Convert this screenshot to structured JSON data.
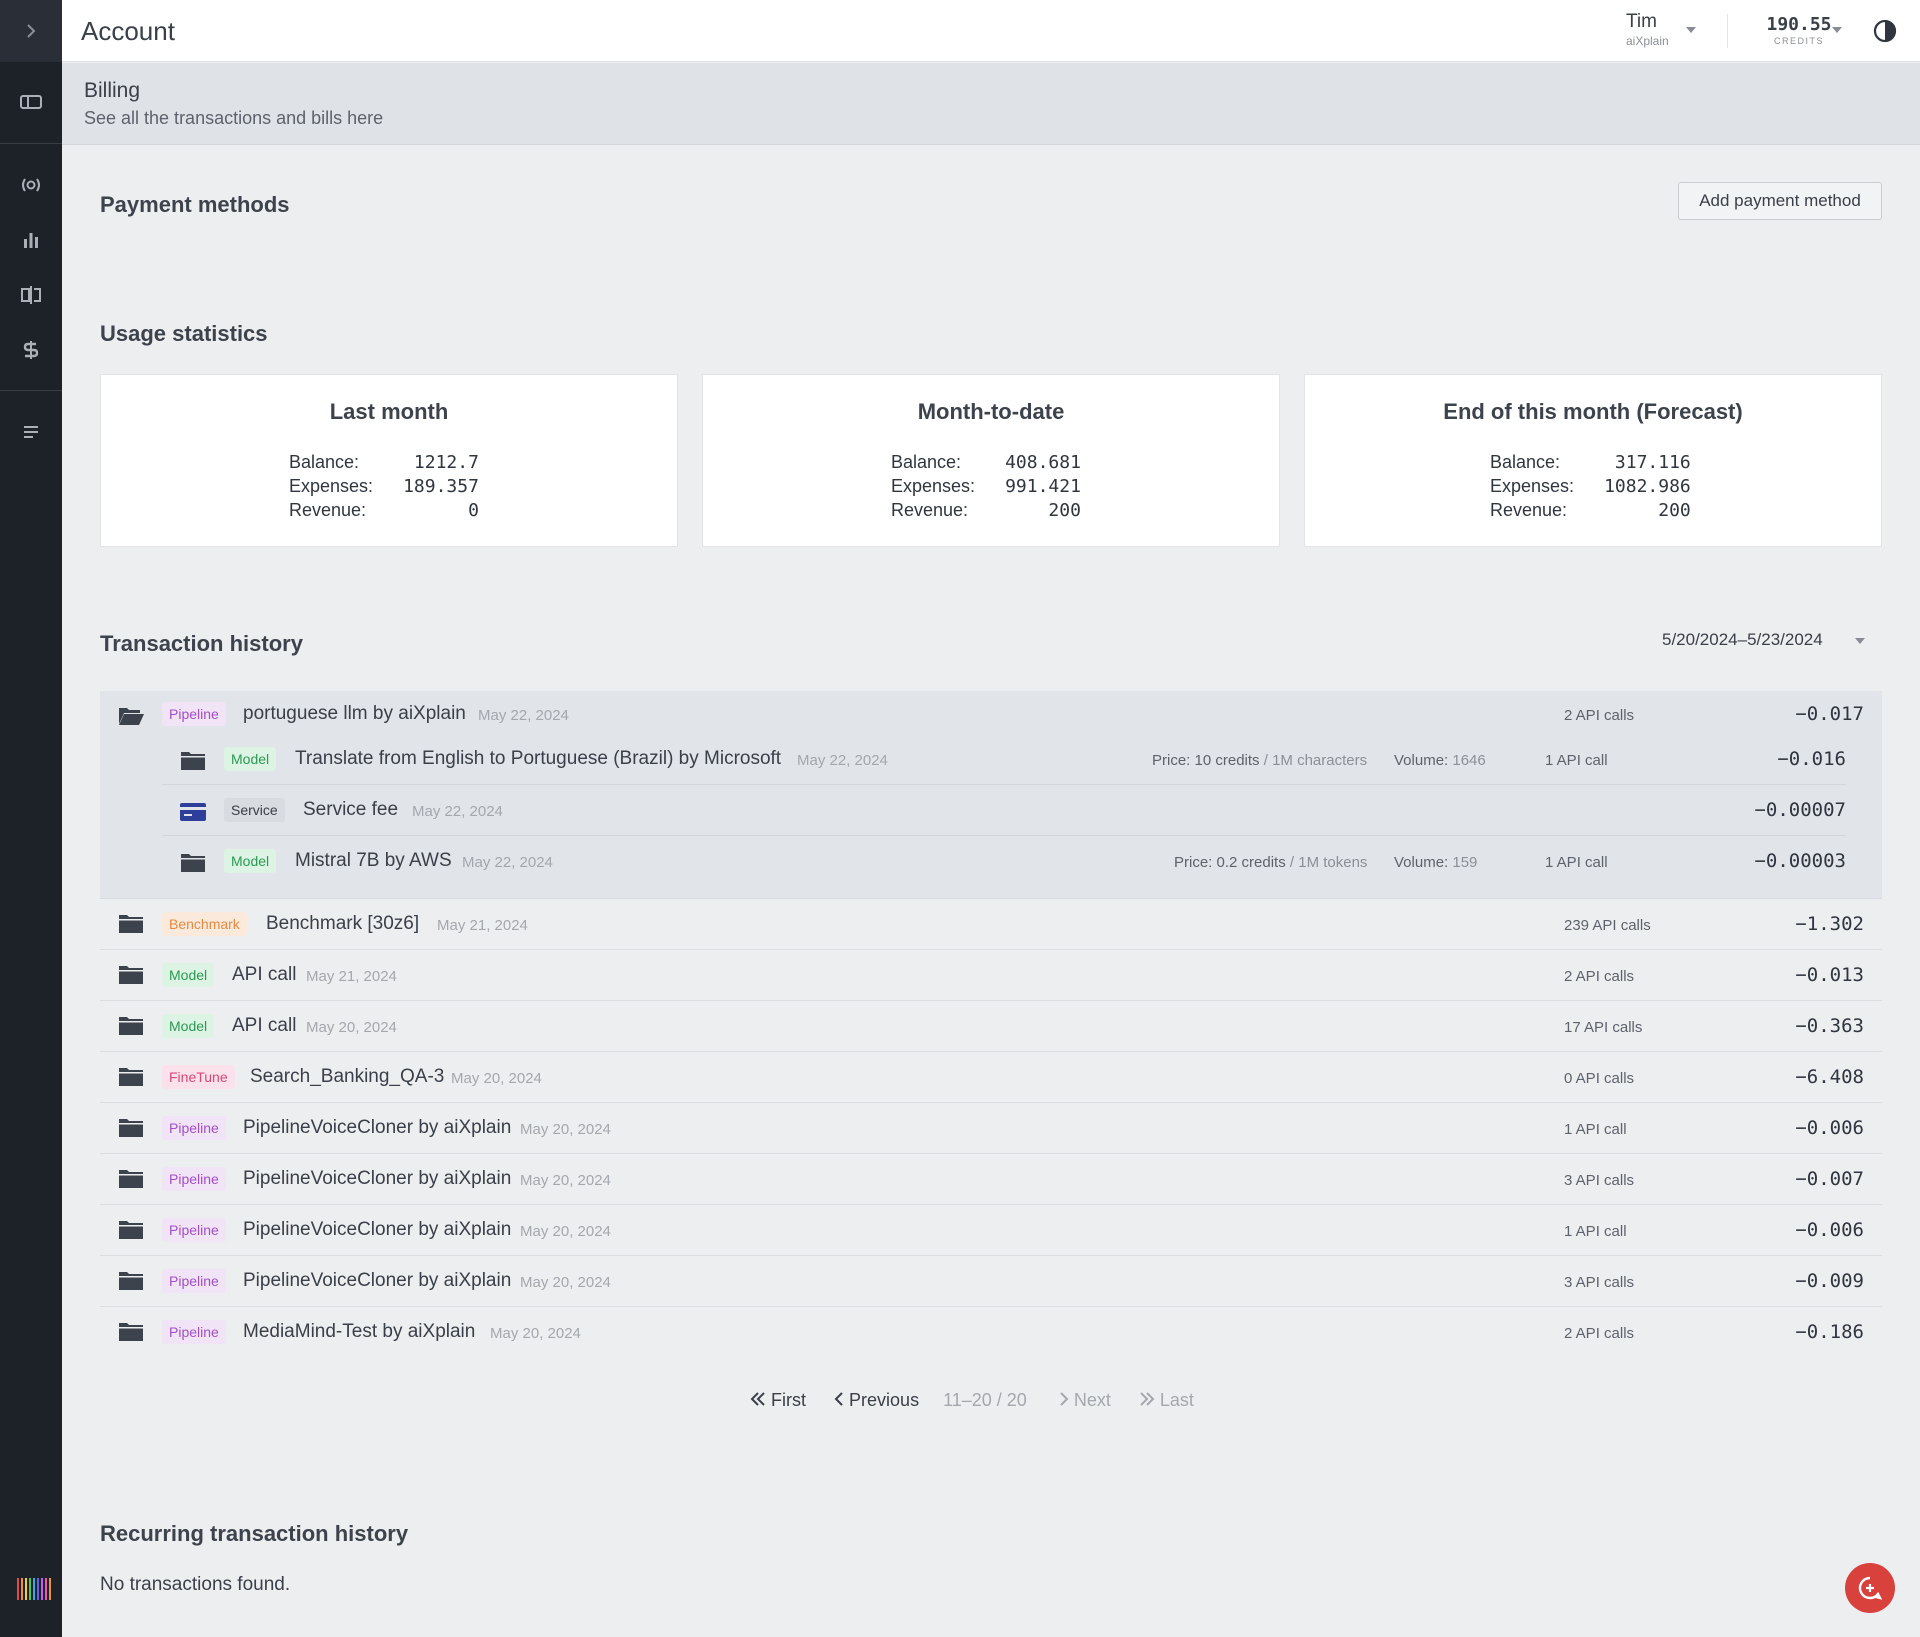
{
  "header": {
    "title": "Account"
  },
  "user": {
    "name": "Tim",
    "org": "aiXplain"
  },
  "credits": {
    "value": "190.55",
    "label": "CREDITS"
  },
  "page": {
    "title": "Billing",
    "subtitle": "See all the transactions and bills here"
  },
  "payment_methods": {
    "title": "Payment methods",
    "add_button": "Add payment method"
  },
  "usage": {
    "title": "Usage statistics",
    "labels": {
      "balance": "Balance:",
      "expenses": "Expenses:",
      "revenue": "Revenue:"
    },
    "cards": [
      {
        "title": "Last month",
        "balance": "1212.7",
        "expenses": "189.357",
        "revenue": "0"
      },
      {
        "title": "Month-to-date",
        "balance": "408.681",
        "expenses": "991.421",
        "revenue": "200"
      },
      {
        "title": "End of this month (Forecast)",
        "balance": "317.116",
        "expenses": "1082.986",
        "revenue": "200"
      }
    ]
  },
  "transactions": {
    "title": "Transaction history",
    "date_range": "5/20/2024–5/23/2024",
    "group": {
      "tag": "Pipeline",
      "name": "portuguese llm by aiXplain",
      "date": "May 22, 2024",
      "calls": "2 API calls",
      "amount": "−0.017",
      "children": [
        {
          "tag": "Model",
          "name": "Translate from English to Portuguese (Brazil) by Microsoft",
          "date": "May 22, 2024",
          "price_label": "Price:",
          "price_value": "10 credits",
          "price_unit": "/ 1M characters",
          "volume_label": "Volume:",
          "volume_value": "1646",
          "calls": "1 API call",
          "amount": "−0.016"
        },
        {
          "tag": "Service",
          "name": "Service fee",
          "date": "May 22, 2024",
          "amount": "−0.00007"
        },
        {
          "tag": "Model",
          "name": "Mistral 7B by AWS",
          "date": "May 22, 2024",
          "price_label": "Price:",
          "price_value": "0.2 credits",
          "price_unit": "/ 1M tokens",
          "volume_label": "Volume:",
          "volume_value": "159",
          "calls": "1 API call",
          "amount": "−0.00003"
        }
      ]
    },
    "rows": [
      {
        "tag": "Benchmark",
        "name": "Benchmark [30z6]",
        "date": "May 21, 2024",
        "calls": "239 API calls",
        "amount": "−1.302"
      },
      {
        "tag": "Model",
        "name": "API call",
        "date": "May 21, 2024",
        "calls": "2 API calls",
        "amount": "−0.013"
      },
      {
        "tag": "Model",
        "name": "API call",
        "date": "May 20, 2024",
        "calls": "17 API calls",
        "amount": "−0.363"
      },
      {
        "tag": "FineTune",
        "name": "Search_Banking_QA-3",
        "date": "May 20, 2024",
        "calls": "0 API calls",
        "amount": "−6.408"
      },
      {
        "tag": "Pipeline",
        "name": "PipelineVoiceCloner by aiXplain",
        "date": "May 20, 2024",
        "calls": "1 API call",
        "amount": "−0.006"
      },
      {
        "tag": "Pipeline",
        "name": "PipelineVoiceCloner by aiXplain",
        "date": "May 20, 2024",
        "calls": "3 API calls",
        "amount": "−0.007"
      },
      {
        "tag": "Pipeline",
        "name": "PipelineVoiceCloner by aiXplain",
        "date": "May 20, 2024",
        "calls": "1 API call",
        "amount": "−0.006"
      },
      {
        "tag": "Pipeline",
        "name": "PipelineVoiceCloner by aiXplain",
        "date": "May 20, 2024",
        "calls": "3 API calls",
        "amount": "−0.009"
      },
      {
        "tag": "Pipeline",
        "name": "MediaMind-Test by aiXplain",
        "date": "May 20, 2024",
        "calls": "2 API calls",
        "amount": "−0.186"
      }
    ]
  },
  "pagination": {
    "first": "First",
    "previous": "Previous",
    "range": "11–20 / 20",
    "next": "Next",
    "last": "Last"
  },
  "recurring": {
    "title": "Recurring transaction history",
    "empty": "No transactions found."
  },
  "colors": {
    "sidebar": "#1d2128",
    "fab": "#d9413d",
    "pipeline": "#a24fc6",
    "model": "#2a9a52",
    "benchmark": "#e58a42",
    "finetune": "#d9467a"
  },
  "icons": {
    "sidebar": [
      "chevron-right-icon",
      "dashboard-icon",
      "broadcast-icon",
      "bar-chart-icon",
      "compare-icon",
      "billing-icon",
      "list-icon"
    ],
    "row": "folder-icon",
    "group": "folder-open-icon",
    "service": "credit-card-icon"
  }
}
